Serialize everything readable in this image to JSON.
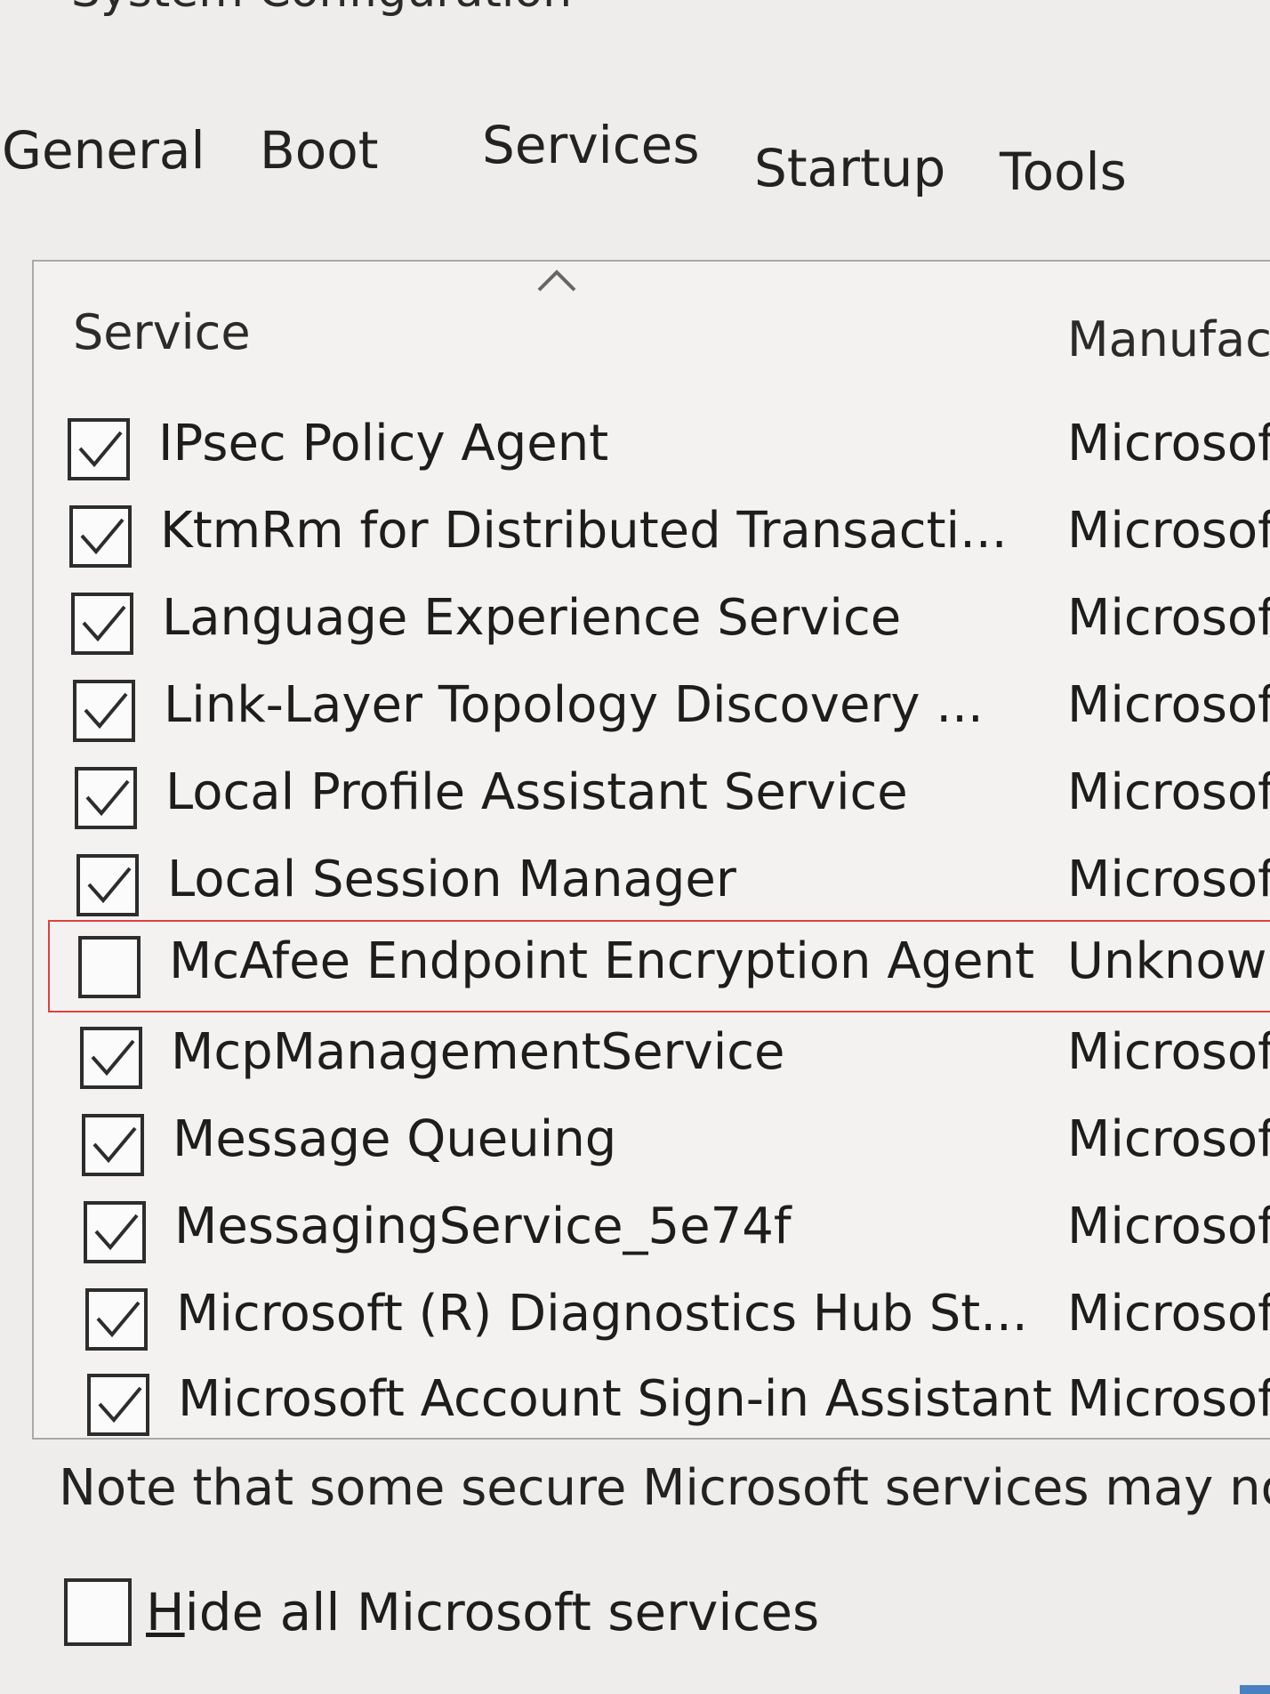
{
  "window": {
    "title": "System Configuration"
  },
  "tabs": [
    {
      "label": "General"
    },
    {
      "label": "Boot"
    },
    {
      "label": "Services",
      "active": true
    },
    {
      "label": "Startup"
    },
    {
      "label": "Tools"
    }
  ],
  "services": {
    "columns": {
      "service": "Service",
      "manufacturer": "Manufac"
    },
    "rows": [
      {
        "name": "IPsec Policy Agent",
        "manufacturer": "Microsof",
        "checked": true
      },
      {
        "name": "KtmRm for Distributed Transacti...",
        "manufacturer": "Microsof",
        "checked": true
      },
      {
        "name": "Language Experience Service",
        "manufacturer": "Microsof",
        "checked": true
      },
      {
        "name": "Link-Layer Topology Discovery ...",
        "manufacturer": "Microsof",
        "checked": true
      },
      {
        "name": "Local Profile Assistant Service",
        "manufacturer": "Microsof",
        "checked": true
      },
      {
        "name": "Local Session Manager",
        "manufacturer": "Microsof",
        "checked": true
      },
      {
        "name": "McAfee Endpoint Encryption Agent",
        "manufacturer": "Unknowr",
        "checked": false,
        "highlighted": true
      },
      {
        "name": "McpManagementService",
        "manufacturer": "Microsof",
        "checked": true
      },
      {
        "name": "Message Queuing",
        "manufacturer": "Microsof",
        "checked": true
      },
      {
        "name": "MessagingService_5e74f",
        "manufacturer": "Microsof",
        "checked": true
      },
      {
        "name": "Microsoft (R) Diagnostics Hub St...",
        "manufacturer": "Microsof",
        "checked": true
      },
      {
        "name": "Microsoft Account Sign-in Assistant",
        "manufacturer": "Microsof",
        "checked": true
      }
    ]
  },
  "note": "Note that some secure Microsoft services may not",
  "hide_ms": {
    "label_first": "H",
    "label_rest": "ide all Microsoft services",
    "checked": false
  },
  "colors": {
    "highlight": "#e0403f",
    "background": "#eeedeb"
  }
}
